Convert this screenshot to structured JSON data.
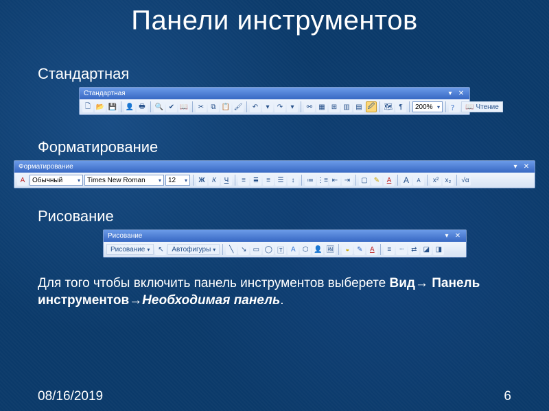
{
  "title": "Панели инструментов",
  "sections": {
    "standard": "Стандартная",
    "formatting": "Форматирование",
    "drawing": "Рисование"
  },
  "toolbars": {
    "standard": {
      "title": "Стандартная",
      "zoom_value": "200%",
      "read_label": "Чтение"
    },
    "formatting": {
      "title": "Форматирование",
      "style_value": "Обычный",
      "font_value": "Times New Roman",
      "size_value": "12",
      "bold_glyph": "Ж",
      "italic_glyph": "К",
      "underline_glyph": "Ч",
      "font_color_glyph": "A",
      "grow_font_glyph": "A",
      "shrink_font_glyph": "A",
      "super_glyph": "x²",
      "sub_glyph": "x₂",
      "sqrt_glyph": "√α"
    },
    "drawing": {
      "title": "Рисование",
      "draw_label": "Рисование",
      "autoshapes_label": "Автофигуры",
      "text_glyph": "A",
      "font_color_glyph": "A"
    }
  },
  "instruction": {
    "prefix": "Для того чтобы включить панель инструментов выберете ",
    "view": "Вид",
    "arrow": "→",
    "panel": "Панель инструментов",
    "arrow2": "→",
    "needed": "Необходимая панель",
    "period": "."
  },
  "footer": {
    "date": "08/16/2019",
    "page": "6"
  }
}
